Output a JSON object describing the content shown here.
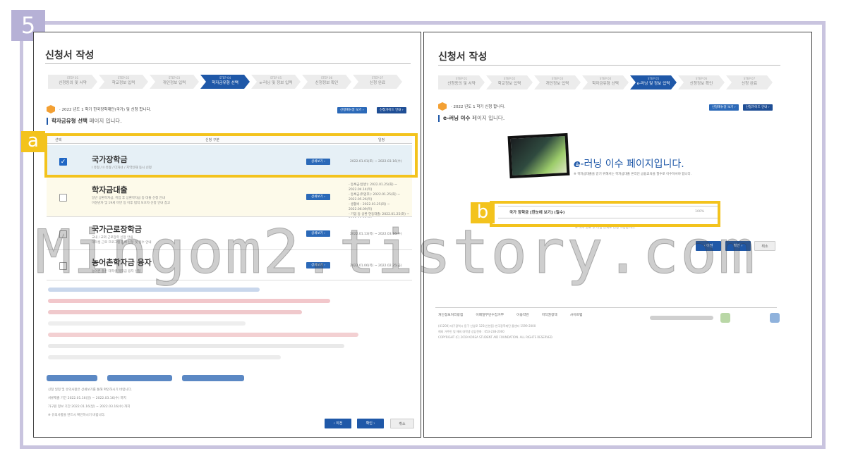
{
  "badge": {
    "step": "5",
    "left_tag": "a",
    "right_tag": "b"
  },
  "left": {
    "title": "신청서 작성",
    "steps": [
      {
        "num": "STEP 01",
        "label": "신청동의 및 서약"
      },
      {
        "num": "STEP 02",
        "label": "학교정보 입력"
      },
      {
        "num": "STEP 03",
        "label": "개인정보 입력"
      },
      {
        "num": "STEP 04",
        "label": "학자금유형 선택"
      },
      {
        "num": "STEP 05",
        "label": "e-러닝 및 정보 입력"
      },
      {
        "num": "STEP 06",
        "label": "신청정보 확인"
      },
      {
        "num": "STEP 07",
        "label": "신청 완료"
      }
    ],
    "notice": "· 2022 년도 1 학기 한국장학재단(국가) 및 신청 합니다.",
    "buttons": {
      "guide": "신청매뉴얼 보기 ›",
      "guide2": "신청가이드 안내 ›"
    },
    "heading": "학자금유형 선택",
    "heading_suffix": "페이지 입니다.",
    "table_head": {
      "select": "선택",
      "type": "신청 구분",
      "period": "일정"
    },
    "rows": [
      {
        "title": "국가장학금",
        "desc": "I 유형 / II 유형 / 다자녀 / 지역인재 동시 신청",
        "detail": "상세보기 ›",
        "period": "2022.01.01(토) ~ 2022.03.16(수)"
      },
      {
        "title": "학자금대출",
        "desc": "일반 상환학자금, 취업 후 상환학자금 등 대출 신청 안내\n미성년자 및 19세 미만 등 이후 법적 보호자 신청 안내 참고",
        "detail": "상세보기 ›",
        "period": "- 등록금(일반): 2022.01.25(화) ~ 2022.04.14(목)\n- 등록금(취업후): 2022.01.25(화) ~ 2022.05.26(목)\n- 생활비 : 2022.01.25(화) ~ 2022.06.09(목)\n- 기업 등 상환 연동대출: 2022.01.25(화) ~ 2022.01.23(일)"
      },
      {
        "title": "국가근로장학금",
        "desc": "교내 / 교외 근로장학 신청 안내\n대학생 근로 프로그램 참여 신청 및 접수 안내",
        "detail": "상세보기 ›",
        "period": "2022.01.13(목) ~ 2022.03.16(수)"
      },
      {
        "title": "농어촌학자금 융자",
        "desc": "농어촌 출신 대학생 학자금 융자 신청",
        "detail": "상세보기 ›",
        "period": "2022.01.06(목) ~ 2022.02.25(금)"
      }
    ],
    "info_lines": [
      "신청 일정 및 유의사항은 상세보기를 통해 확인하시기 바랍니다.",
      "서류제출 기간 2022.01.16(일) ~ 2022.03.16(수) 까지",
      "가구원 정보 기간 2022.01.16(일) ~ 2022.03.16(수) 까지",
      "※ 유의사항을 반드시 확인하시기 바랍니다."
    ],
    "nav": {
      "prev": "‹ 이전",
      "next": "확인 ›",
      "cancel": "취소"
    }
  },
  "right": {
    "title": "신청서 작성",
    "steps": [
      {
        "num": "STEP 01",
        "label": "신청동의 및 서약"
      },
      {
        "num": "STEP 02",
        "label": "학교정보 입력"
      },
      {
        "num": "STEP 03",
        "label": "개인정보 입력"
      },
      {
        "num": "STEP 04",
        "label": "학자금유형 선택"
      },
      {
        "num": "STEP 05",
        "label": "e-러닝 및 정보 입력"
      },
      {
        "num": "STEP 06",
        "label": "신청정보 확인"
      },
      {
        "num": "STEP 07",
        "label": "신청 완료"
      }
    ],
    "notice": "· 2022 년도 1 학기 신청 합니다.",
    "buttons": {
      "guide": "신청매뉴얼 보기 ›",
      "guide2": "신청가이드 안내 ›"
    },
    "heading": "e-러닝 이수",
    "heading_suffix": "페이지 입니다.",
    "elearn_title_prefix": "e",
    "elearn_title": "-러닝 이수 페이지입니다.",
    "elearn_sub": "※ 학자금대출을 받기 위해서는 학자금대출 온라인 금융교육을 필수로 이수하셔야 합니다.",
    "course_label": "국가 장학금 [한눈에 보기] (필수)",
    "course_pct": "100%",
    "note": "※ 이수 완료 후 다음 단계로 진행 가능합니다.",
    "nav": {
      "prev": "‹ 이전",
      "next": "확인 ›",
      "cancel": "취소"
    },
    "footer_links": [
      "개인정보처리방침",
      "이메일무단수집거부",
      "이용약관",
      "저작권정책",
      "사이트맵"
    ],
    "footer_lines": [
      "(41200) 대구광역시 동구 신암로 125(신천동) 한국장학재단 콜센터 1599-2000",
      "해외 거주민 및 해외 대학생 상담전화 : 053-238-2000",
      "COPYRIGHT (C) 2019 KOREA STUDENT AID FOUNDATION. ALL RIGHTS RESERVED."
    ]
  },
  "watermark": "Mingom2.tistory.com",
  "colors": {
    "accent": "#1f58a8",
    "highlight": "#f3c31d",
    "frame": "#c9c4df",
    "badge": "#b6b1d6"
  }
}
